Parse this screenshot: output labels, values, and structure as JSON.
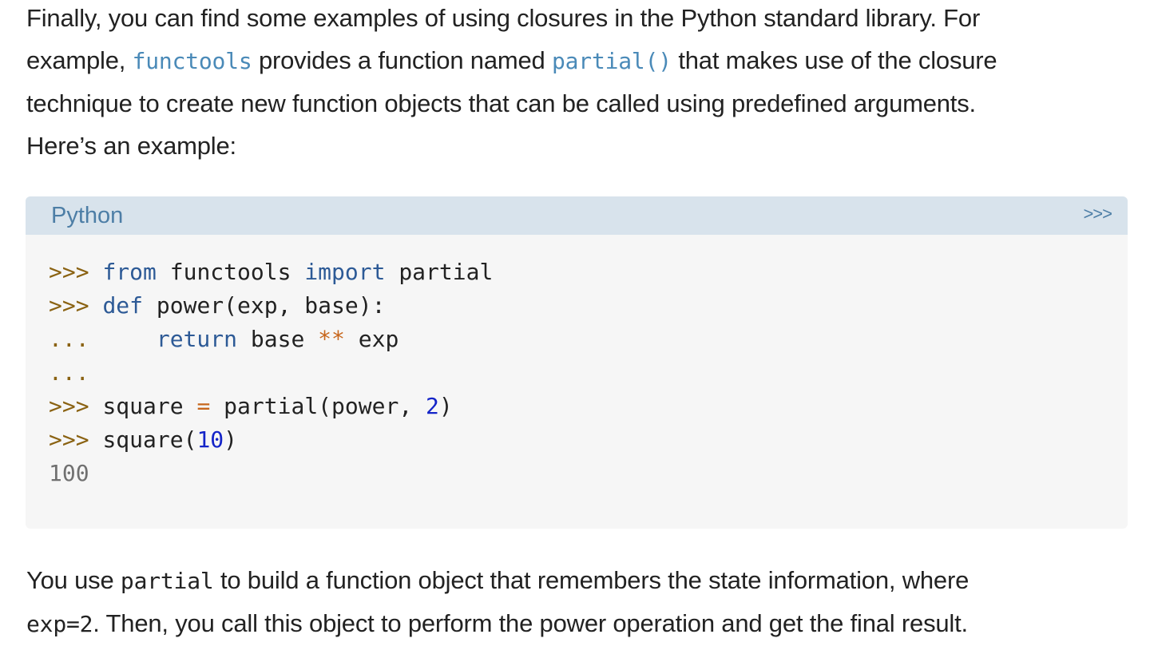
{
  "paragraph_1": {
    "line_1": "Finally, you can find some examples of using closures in the Python standard library. For",
    "line_2_start": "example, ",
    "link_functools": "functools",
    "line_2_mid": " provides a function named ",
    "link_partial": "partial()",
    "line_2_end": " that makes use of the closure",
    "line_3": "technique to create new function objects that can be called using predefined arguments.",
    "line_4": "Here’s an example:"
  },
  "code_block": {
    "language": "Python",
    "prompt_toggle": ">>>",
    "lines": [
      [
        {
          "t": "prompt",
          "v": ">>> "
        },
        {
          "t": "kw",
          "v": "from"
        },
        {
          "t": "text",
          "v": " functools "
        },
        {
          "t": "kw",
          "v": "import"
        },
        {
          "t": "text",
          "v": " partial"
        }
      ],
      [
        {
          "t": "prompt",
          "v": ">>> "
        },
        {
          "t": "kw",
          "v": "def"
        },
        {
          "t": "text",
          "v": " power(exp, base):"
        }
      ],
      [
        {
          "t": "prompt",
          "v": "...     "
        },
        {
          "t": "kw",
          "v": "return"
        },
        {
          "t": "text",
          "v": " base "
        },
        {
          "t": "op",
          "v": "**"
        },
        {
          "t": "text",
          "v": " exp"
        }
      ],
      [
        {
          "t": "prompt",
          "v": "..."
        }
      ],
      [
        {
          "t": "prompt",
          "v": ">>> "
        },
        {
          "t": "text",
          "v": "square "
        },
        {
          "t": "op",
          "v": "="
        },
        {
          "t": "text",
          "v": " partial(power, "
        },
        {
          "t": "num",
          "v": "2"
        },
        {
          "t": "text",
          "v": ")"
        }
      ],
      [
        {
          "t": "prompt",
          "v": ">>> "
        },
        {
          "t": "text",
          "v": "square("
        },
        {
          "t": "num",
          "v": "10"
        },
        {
          "t": "text",
          "v": ")"
        }
      ],
      [
        {
          "t": "out",
          "v": "100"
        }
      ]
    ]
  },
  "paragraph_2": {
    "line_1_start": "You use ",
    "code_partial": "partial",
    "line_1_end": " to build a function object that remembers the state information, where",
    "code_exp": "exp=2",
    "line_2_end": ". Then, you call this object to perform the power operation and get the final result."
  }
}
